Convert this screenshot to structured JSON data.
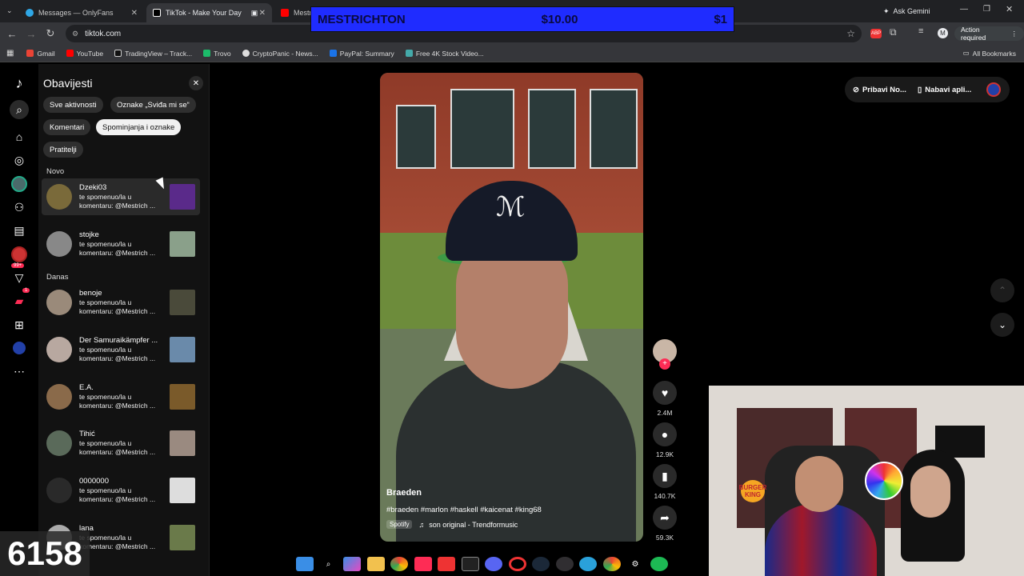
{
  "browser": {
    "tabs": [
      {
        "title": "Messages — OnlyFans",
        "active": false
      },
      {
        "title": "TikTok - Make Your Day",
        "active": true
      },
      {
        "title": "Mestri",
        "active": false
      }
    ],
    "ask_gemini": "Ask Gemini",
    "url": "tiktok.com",
    "action_required": "Action required",
    "profile_letter": "M",
    "bookmarks": [
      "Gmail",
      "YouTube",
      "TradingView – Track...",
      "Trovo",
      "CryptoPanic - News...",
      "PayPal: Summary",
      "Free 4K Stock Video..."
    ],
    "all_bookmarks": "All Bookmarks"
  },
  "banner": {
    "name": "MESTRICHTON",
    "amount": "$10.00",
    "right": "$1"
  },
  "rail": {
    "badge_inbox": "99+",
    "badge_messages": "1"
  },
  "panel": {
    "title": "Obavijesti",
    "chips": [
      "Sve aktivnosti",
      "Oznake „Sviđa mi se“",
      "Komentari",
      "Spominjanja i oznake",
      "Pratitelji"
    ],
    "sections": {
      "new": "Novo",
      "today": "Danas"
    },
    "notifications": [
      {
        "name": "Dzeki03",
        "line1": "te spomenuo/la u",
        "line2": "komentaru: @Mestrich ..."
      },
      {
        "name": "stojke",
        "line1": "te spomenuo/la u",
        "line2": "komentaru: @Mestrich ..."
      },
      {
        "name": "benoje",
        "line1": "te spomenuo/la u",
        "line2": "komentaru: @Mestrich ..."
      },
      {
        "name": "Der Samuraikämpfer ...",
        "line1": "te spomenuo/la u",
        "line2": "komentaru: @Mestrich ..."
      },
      {
        "name": "E.A.",
        "line1": "te spomenuo/la u",
        "line2": "komentaru: @Mestrich ..."
      },
      {
        "name": "Tihić",
        "line1": "te spomenuo/la u",
        "line2": "komentaru: @Mestrich ..."
      },
      {
        "name": "0000000",
        "line1": "te spomenuo/la u",
        "line2": "komentaru: @Mestrich ..."
      },
      {
        "name": "lana",
        "line1": "te spomenuo/la u",
        "line2": "komentaru: @Mestrich ..."
      }
    ]
  },
  "video": {
    "author": "Braeden",
    "tags": "#braeden #marlon #haskell #kaicenat #king68",
    "spotify": "Spotify",
    "music": "son original - Trendformusic",
    "likes": "2.4M",
    "comments": "12.9K",
    "saves": "140.7K",
    "shares": "59.3K"
  },
  "topright": {
    "get_coins": "Pribavi No...",
    "get_app": "Nabavi apli..."
  },
  "overlay": {
    "counter": "6158",
    "sponsor": "BURGER KING"
  },
  "colors": {
    "tiktok_red": "#fe2c55",
    "banner_blue": "#1f2cff",
    "panel_bg": "#121212"
  }
}
